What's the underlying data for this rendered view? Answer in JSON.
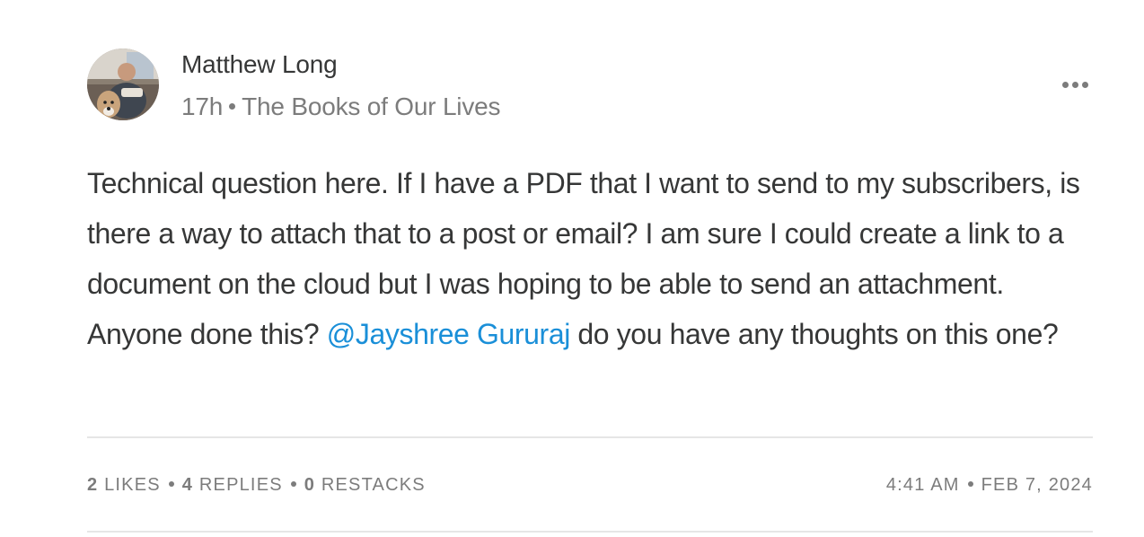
{
  "post": {
    "author": {
      "name": "Matthew Long",
      "avatar_icon": "user-avatar-photo"
    },
    "meta": {
      "time_ago": "17h",
      "publication": "The Books of Our Lives"
    },
    "more_icon": "ellipsis-icon",
    "body": {
      "text_before": "Technical question here. If I have a PDF that I want to send to my subscribers, is there a way to attach that to a post or email? I am sure I could create a link to a document on the cloud but I was hoping to be able to send an attachment. Anyone done this? ",
      "mention": "@Jayshree Gururaj",
      "text_after": " do you have any thoughts on this one?"
    },
    "stats": {
      "likes_count": "2",
      "likes_label": "LIKES",
      "replies_count": "4",
      "replies_label": "REPLIES",
      "restacks_count": "0",
      "restacks_label": "RESTACKS"
    },
    "timestamp": {
      "time": "4:41 AM",
      "date": "FEB 7, 2024"
    },
    "colors": {
      "text": "#363737",
      "muted": "#7c7c7c",
      "mention": "#1a8fd8",
      "divider": "#e6e6e6"
    }
  }
}
